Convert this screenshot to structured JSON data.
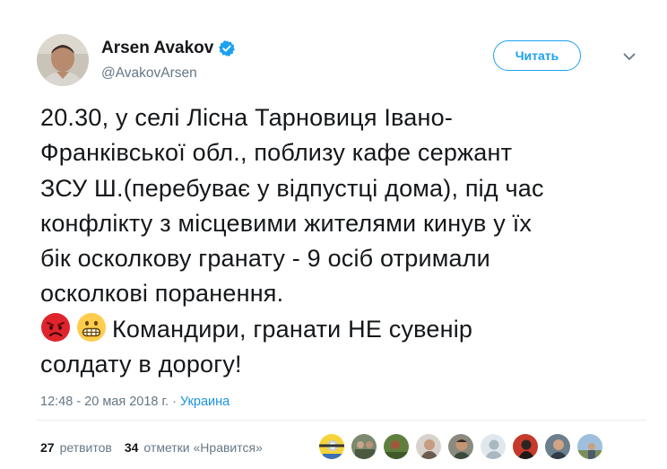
{
  "author": {
    "display_name": "Arsen Avakov",
    "handle": "@AvakovArsen",
    "verified": true,
    "verified_icon": "verified-badge-icon"
  },
  "follow_button": {
    "label": "Читать"
  },
  "caret_icon": "chevron-down-icon",
  "tweet_text_lines": [
    "20.30, у селі Лісна Тарновиця Івано-",
    "Франківської обл., поблизу кафе сержант",
    "ЗСУ Ш.(перебуває у відпустці дома), під час",
    "конфлікту з місцевими жителями кинув у їх",
    "бік осколкову гранату - 9 осіб отримали",
    "осколкові поранення."
  ],
  "tweet_emoji_line": {
    "emojis": [
      "angry-face-emoji",
      "grimacing-face-emoji"
    ],
    "text": "Командири, гранати НЕ сувенір"
  },
  "tweet_last_line": "солдату в дорогу!",
  "meta": {
    "time_date": "12:48 - 20 мая 2018 г.",
    "separator": "·",
    "place": "Украина"
  },
  "stats": {
    "retweets_count": "27",
    "retweets_label": "ретвитов",
    "likes_count": "34",
    "likes_label": "отметки «Нравится»"
  },
  "likers": [
    "minion-avatar",
    "group-avatar",
    "landscape-avatar",
    "person-avatar",
    "person-avatar-2",
    "default-avatar",
    "red-avatar",
    "person-avatar-3",
    "outdoor-avatar"
  ],
  "colors": {
    "accent": "#1da1f2",
    "link": "#1b95e0",
    "muted": "#657786",
    "text": "#14171a",
    "divider": "#e6ecf0"
  }
}
